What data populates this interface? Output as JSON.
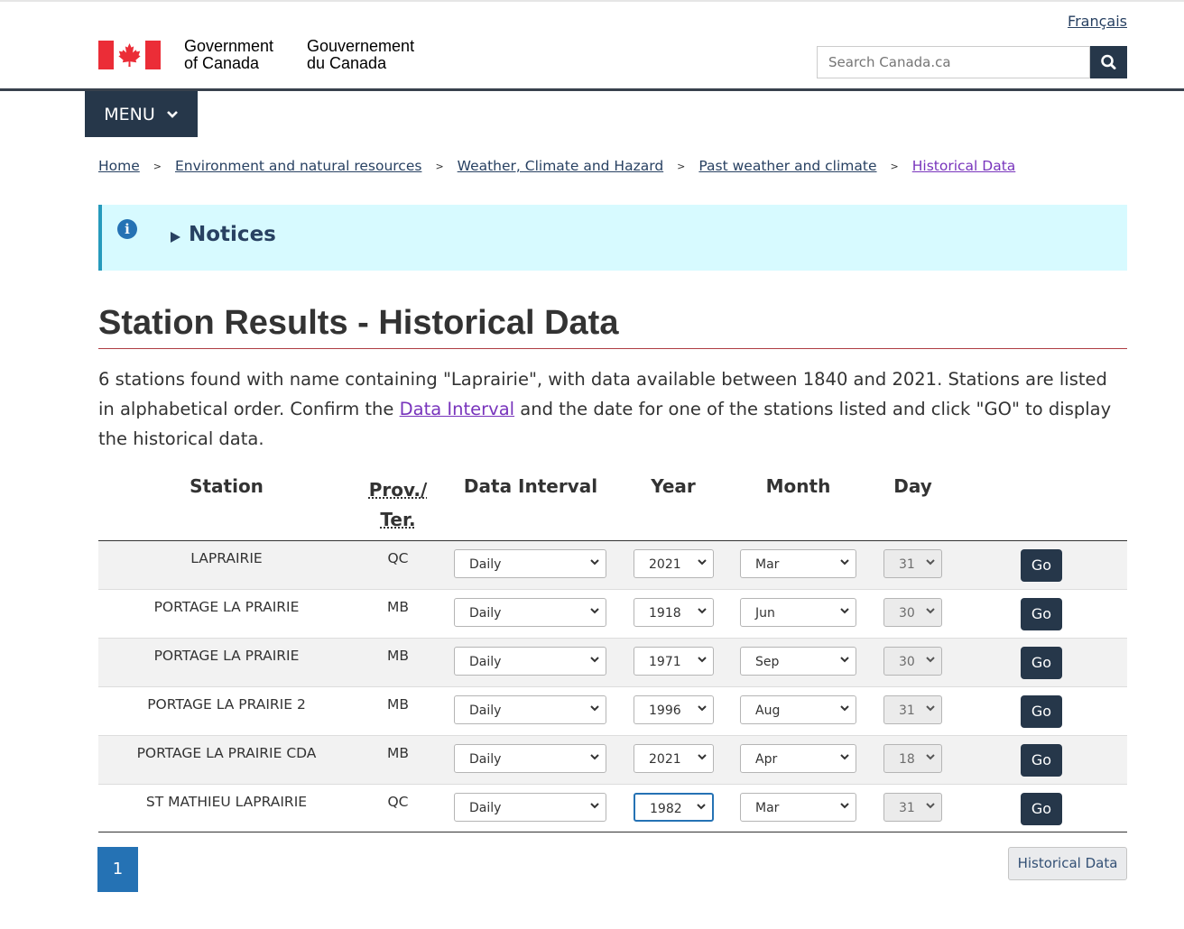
{
  "header": {
    "lang_toggle": "Français",
    "signature_en": [
      "Government",
      "of Canada"
    ],
    "signature_fr": [
      "Gouvernement",
      "du Canada"
    ],
    "search_placeholder": "Search Canada.ca",
    "menu_label": "MENU"
  },
  "breadcrumb": [
    "Home",
    "Environment and natural resources",
    "Weather, Climate and Hazard",
    "Past weather and climate",
    "Historical Data"
  ],
  "breadcrumb_sep": ">",
  "notice": {
    "label": "Notices"
  },
  "page": {
    "title": "Station Results - Historical Data",
    "intro_before": "6 stations found with name containing \"Laprairie\", with data available between 1840 and 2021. Stations are listed in alphabetical order. Confirm the ",
    "intro_link": "Data Interval",
    "intro_after": " and the date for one of the stations listed and click \"GO\" to display the historical data."
  },
  "table": {
    "headers": {
      "station": "Station",
      "prov_line1": "Prov./",
      "prov_line2": "Ter.",
      "interval": "Data Interval",
      "year": "Year",
      "month": "Month",
      "day": "Day"
    },
    "go_label": "Go",
    "rows": [
      {
        "station": "LAPRAIRIE",
        "prov": "QC",
        "interval": "Daily",
        "year": "2021",
        "month": "Mar",
        "day": "31"
      },
      {
        "station": "PORTAGE LA PRAIRIE",
        "prov": "MB",
        "interval": "Daily",
        "year": "1918",
        "month": "Jun",
        "day": "30"
      },
      {
        "station": "PORTAGE LA PRAIRIE",
        "prov": "MB",
        "interval": "Daily",
        "year": "1971",
        "month": "Sep",
        "day": "30"
      },
      {
        "station": "PORTAGE LA PRAIRIE 2",
        "prov": "MB",
        "interval": "Daily",
        "year": "1996",
        "month": "Aug",
        "day": "31"
      },
      {
        "station": "PORTAGE LA PRAIRIE CDA",
        "prov": "MB",
        "interval": "Daily",
        "year": "2021",
        "month": "Apr",
        "day": "18"
      },
      {
        "station": "ST MATHIEU LAPRAIRIE",
        "prov": "QC",
        "interval": "Daily",
        "year": "1982",
        "month": "Mar",
        "day": "31"
      }
    ]
  },
  "pagination": {
    "current": "1"
  },
  "footer_button": "Historical Data",
  "colors": {
    "navy": "#26374a",
    "link": "#284162",
    "visited": "#7834bc",
    "accent_red": "#af3c43",
    "notice_bg": "#d7faff",
    "page_blue": "#2572b4"
  }
}
